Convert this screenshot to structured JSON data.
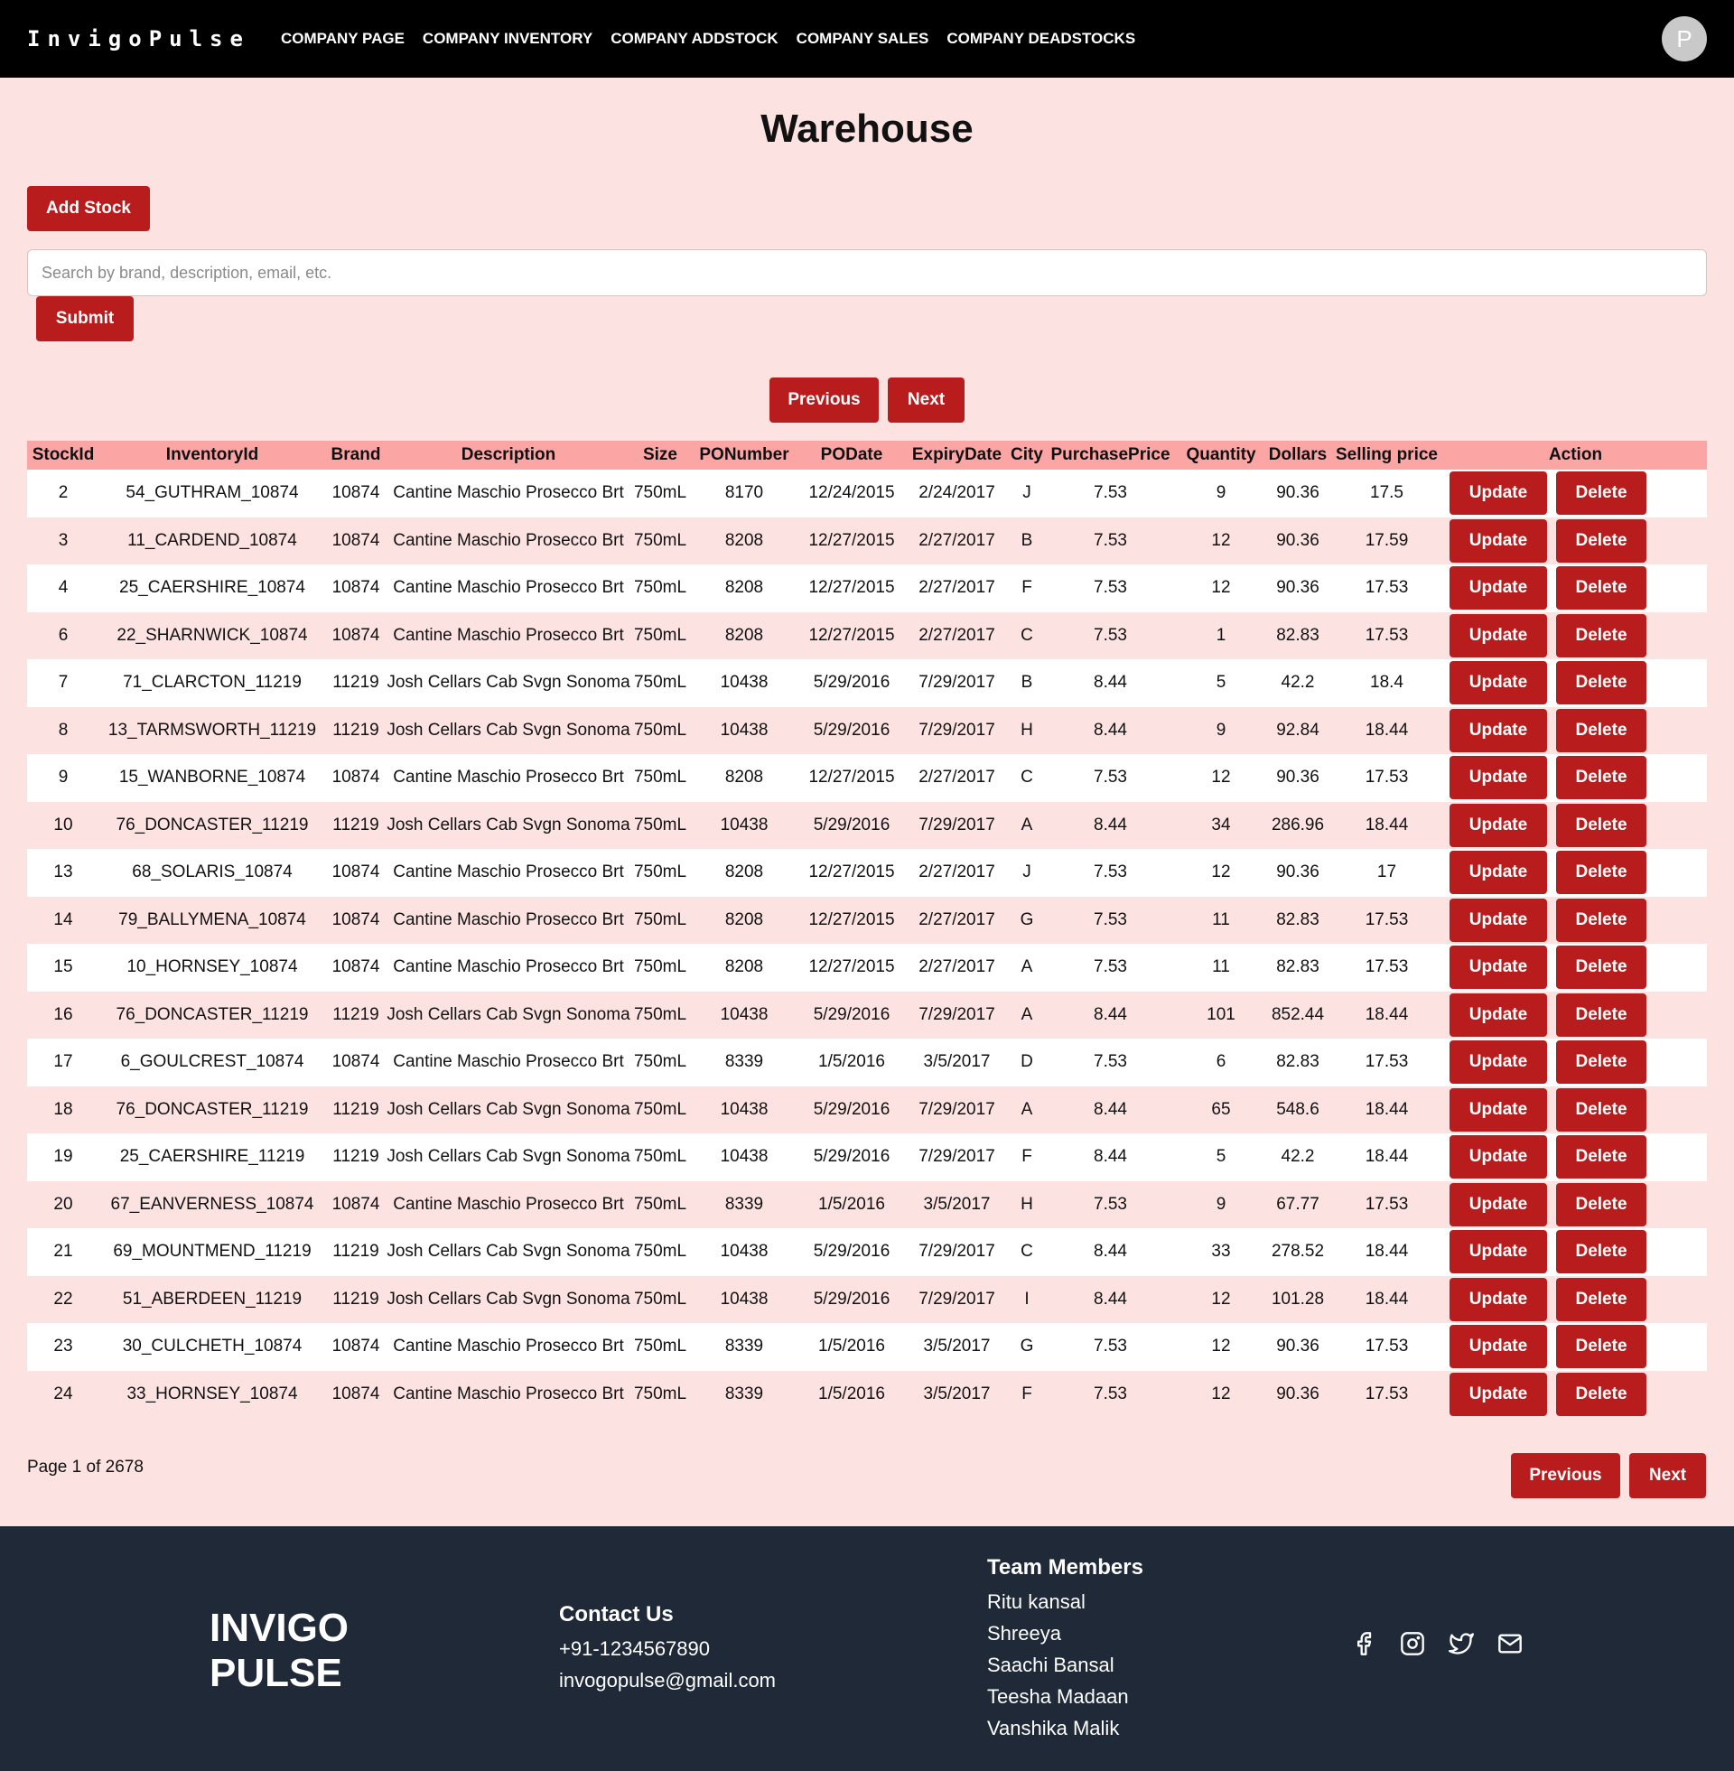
{
  "navbar": {
    "brand": "InvigoPulse",
    "links": [
      "COMPANY PAGE",
      "COMPANY INVENTORY",
      "COMPANY ADDSTOCK",
      "COMPANY SALES",
      "COMPANY DEADSTOCKS"
    ],
    "avatar_letter": "P"
  },
  "main": {
    "title": "Warehouse",
    "add_stock_label": "Add Stock",
    "search_placeholder": "Search by brand, description, email, etc.",
    "submit_label": "Submit",
    "previous_label": "Previous",
    "next_label": "Next",
    "page_info": "Page 1 of 2678"
  },
  "table": {
    "columns": [
      "StockId",
      "InventoryId",
      "Brand",
      "Description",
      "Size",
      "PONumber",
      "PODate",
      "ExpiryDate",
      "City",
      "PurchasePrice",
      "Quantity",
      "Dollars",
      "Selling price",
      "Action"
    ],
    "update_label": "Update",
    "delete_label": "Delete",
    "rows": [
      [
        "2",
        "54_GUTHRAM_10874",
        "10874",
        "Cantine Maschio Prosecco Brt",
        "750mL",
        "8170",
        "12/24/2015",
        "2/24/2017",
        "J",
        "7.53",
        "9",
        "90.36",
        "17.5"
      ],
      [
        "3",
        "11_CARDEND_10874",
        "10874",
        "Cantine Maschio Prosecco Brt",
        "750mL",
        "8208",
        "12/27/2015",
        "2/27/2017",
        "B",
        "7.53",
        "12",
        "90.36",
        "17.59"
      ],
      [
        "4",
        "25_CAERSHIRE_10874",
        "10874",
        "Cantine Maschio Prosecco Brt",
        "750mL",
        "8208",
        "12/27/2015",
        "2/27/2017",
        "F",
        "7.53",
        "12",
        "90.36",
        "17.53"
      ],
      [
        "6",
        "22_SHARNWICK_10874",
        "10874",
        "Cantine Maschio Prosecco Brt",
        "750mL",
        "8208",
        "12/27/2015",
        "2/27/2017",
        "C",
        "7.53",
        "1",
        "82.83",
        "17.53"
      ],
      [
        "7",
        "71_CLARCTON_11219",
        "11219",
        "Josh Cellars Cab Svgn Sonoma",
        "750mL",
        "10438",
        "5/29/2016",
        "7/29/2017",
        "B",
        "8.44",
        "5",
        "42.2",
        "18.4"
      ],
      [
        "8",
        "13_TARMSWORTH_11219",
        "11219",
        "Josh Cellars Cab Svgn Sonoma",
        "750mL",
        "10438",
        "5/29/2016",
        "7/29/2017",
        "H",
        "8.44",
        "9",
        "92.84",
        "18.44"
      ],
      [
        "9",
        "15_WANBORNE_10874",
        "10874",
        "Cantine Maschio Prosecco Brt",
        "750mL",
        "8208",
        "12/27/2015",
        "2/27/2017",
        "C",
        "7.53",
        "12",
        "90.36",
        "17.53"
      ],
      [
        "10",
        "76_DONCASTER_11219",
        "11219",
        "Josh Cellars Cab Svgn Sonoma",
        "750mL",
        "10438",
        "5/29/2016",
        "7/29/2017",
        "A",
        "8.44",
        "34",
        "286.96",
        "18.44"
      ],
      [
        "13",
        "68_SOLARIS_10874",
        "10874",
        "Cantine Maschio Prosecco Brt",
        "750mL",
        "8208",
        "12/27/2015",
        "2/27/2017",
        "J",
        "7.53",
        "12",
        "90.36",
        "17"
      ],
      [
        "14",
        "79_BALLYMENA_10874",
        "10874",
        "Cantine Maschio Prosecco Brt",
        "750mL",
        "8208",
        "12/27/2015",
        "2/27/2017",
        "G",
        "7.53",
        "11",
        "82.83",
        "17.53"
      ],
      [
        "15",
        "10_HORNSEY_10874",
        "10874",
        "Cantine Maschio Prosecco Brt",
        "750mL",
        "8208",
        "12/27/2015",
        "2/27/2017",
        "A",
        "7.53",
        "11",
        "82.83",
        "17.53"
      ],
      [
        "16",
        "76_DONCASTER_11219",
        "11219",
        "Josh Cellars Cab Svgn Sonoma",
        "750mL",
        "10438",
        "5/29/2016",
        "7/29/2017",
        "A",
        "8.44",
        "101",
        "852.44",
        "18.44"
      ],
      [
        "17",
        "6_GOULCREST_10874",
        "10874",
        "Cantine Maschio Prosecco Brt",
        "750mL",
        "8339",
        "1/5/2016",
        "3/5/2017",
        "D",
        "7.53",
        "6",
        "82.83",
        "17.53"
      ],
      [
        "18",
        "76_DONCASTER_11219",
        "11219",
        "Josh Cellars Cab Svgn Sonoma",
        "750mL",
        "10438",
        "5/29/2016",
        "7/29/2017",
        "A",
        "8.44",
        "65",
        "548.6",
        "18.44"
      ],
      [
        "19",
        "25_CAERSHIRE_11219",
        "11219",
        "Josh Cellars Cab Svgn Sonoma",
        "750mL",
        "10438",
        "5/29/2016",
        "7/29/2017",
        "F",
        "8.44",
        "5",
        "42.2",
        "18.44"
      ],
      [
        "20",
        "67_EANVERNESS_10874",
        "10874",
        "Cantine Maschio Prosecco Brt",
        "750mL",
        "8339",
        "1/5/2016",
        "3/5/2017",
        "H",
        "7.53",
        "9",
        "67.77",
        "17.53"
      ],
      [
        "21",
        "69_MOUNTMEND_11219",
        "11219",
        "Josh Cellars Cab Svgn Sonoma",
        "750mL",
        "10438",
        "5/29/2016",
        "7/29/2017",
        "C",
        "8.44",
        "33",
        "278.52",
        "18.44"
      ],
      [
        "22",
        "51_ABERDEEN_11219",
        "11219",
        "Josh Cellars Cab Svgn Sonoma",
        "750mL",
        "10438",
        "5/29/2016",
        "7/29/2017",
        "I",
        "8.44",
        "12",
        "101.28",
        "18.44"
      ],
      [
        "23",
        "30_CULCHETH_10874",
        "10874",
        "Cantine Maschio Prosecco Brt",
        "750mL",
        "8339",
        "1/5/2016",
        "3/5/2017",
        "G",
        "7.53",
        "12",
        "90.36",
        "17.53"
      ],
      [
        "24",
        "33_HORNSEY_10874",
        "10874",
        "Cantine Maschio Prosecco Brt",
        "750mL",
        "8339",
        "1/5/2016",
        "3/5/2017",
        "F",
        "7.53",
        "12",
        "90.36",
        "17.53"
      ]
    ]
  },
  "footer": {
    "logo_line1": "INVIGO",
    "logo_line2": "PULSE",
    "contact_heading": "Contact Us",
    "phone": "+91-1234567890",
    "email": "invogopulse@gmail.com",
    "team_heading": "Team Members",
    "team": [
      "Ritu kansal",
      "Shreeya",
      "Saachi Bansal",
      "Teesha Madaan",
      "Vanshika Malik"
    ],
    "social_icons": [
      "facebook-icon",
      "instagram-icon",
      "twitter-icon",
      "mail-icon"
    ]
  },
  "colors": {
    "navbar_bg": "#000000",
    "page_bg": "#fde2e2",
    "accent": "#b91c1c",
    "table_header_bg": "#fca5a5",
    "footer_bg": "#1f2937"
  }
}
